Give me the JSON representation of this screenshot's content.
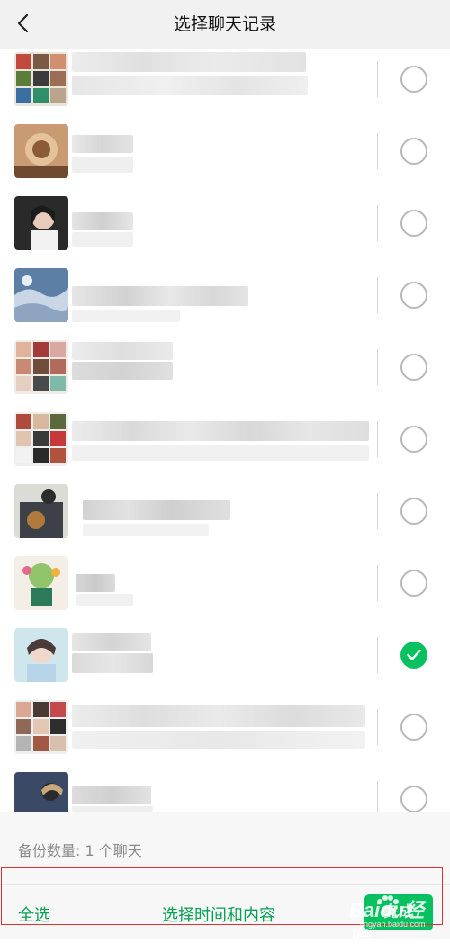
{
  "header": {
    "title": "选择聊天记录"
  },
  "chats": [
    {
      "selected": false
    },
    {
      "selected": false
    },
    {
      "selected": false
    },
    {
      "selected": false
    },
    {
      "selected": false
    },
    {
      "selected": false
    },
    {
      "selected": false
    },
    {
      "selected": false
    },
    {
      "selected": true
    },
    {
      "selected": false
    },
    {
      "selected": false
    }
  ],
  "footer": {
    "backup_count": "备份数量:  1 个聊天",
    "select_all": "全选",
    "select_time_content": "选择时间和内容",
    "done": "完成"
  },
  "watermark": {
    "text": "Baidu经验",
    "url": "jingyan.baidu.com"
  },
  "colors": {
    "accent": "#07c160",
    "accent_text": "#07a155",
    "highlight_frame": "#e0302c"
  },
  "icons": {
    "back": "chevron-left-icon",
    "check": "checkmark-icon"
  }
}
